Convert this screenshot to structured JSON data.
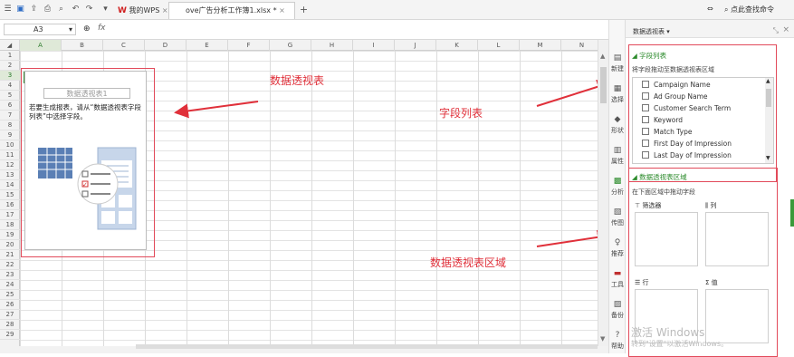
{
  "toolbar": {
    "tab_wps": "我的WPS",
    "tab_file": "ove广告分析工作簿1.xlsx *",
    "right_search": "点此查找命令",
    "new_tab": "+"
  },
  "formula": {
    "name_box": "A3",
    "fx": "fx"
  },
  "columns": [
    "A",
    "B",
    "C",
    "D",
    "E",
    "F",
    "G",
    "H",
    "I",
    "J",
    "K",
    "L",
    "M",
    "N"
  ],
  "rows": [
    "1",
    "2",
    "3",
    "4",
    "5",
    "6",
    "7",
    "8",
    "9",
    "10",
    "11",
    "12",
    "13",
    "14",
    "15",
    "16",
    "17",
    "18",
    "19",
    "20",
    "21",
    "22",
    "23",
    "24",
    "25",
    "26",
    "27",
    "28",
    "29"
  ],
  "pivot_placeholder": {
    "title": "数据透视表1",
    "hint": "若要生成报表，请从“数据透视表字段列表”中选择字段。"
  },
  "sidebar": [
    {
      "label": "新建",
      "icon": "new-icon"
    },
    {
      "label": "选择",
      "icon": "select-icon"
    },
    {
      "label": "形状",
      "icon": "shape-icon"
    },
    {
      "label": "属性",
      "icon": "property-icon"
    },
    {
      "label": "分析",
      "icon": "analyze-icon"
    },
    {
      "label": "传图",
      "icon": "upload-icon"
    },
    {
      "label": "推荐",
      "icon": "recommend-icon"
    },
    {
      "label": "工具",
      "icon": "tools-icon"
    },
    {
      "label": "备份",
      "icon": "backup-icon"
    },
    {
      "label": "帮助",
      "icon": "help-icon"
    }
  ],
  "panel": {
    "title": "数据透视表 ▾",
    "field_list_header": "字段列表",
    "field_list_hint": "将字段拖动至数据透视表区域",
    "fields": [
      "Campaign Name",
      "Ad Group Name",
      "Customer Search Term",
      "Keyword",
      "Match Type",
      "First Day of Impression",
      "Last Day of Impression"
    ],
    "area_header": "数据透视表区域",
    "area_hint": "在下面区域中拖动字段",
    "zones": {
      "filter": "筛选器",
      "columns": "列",
      "rows": "行",
      "values": "值"
    }
  },
  "annotations": {
    "pivot_table": "数据透视表",
    "field_list": "字段列表",
    "pivot_area": "数据透视表区域"
  },
  "watermark": {
    "line1": "激活 Windows",
    "line2": "转到\"设置\"以激活Windows。"
  }
}
